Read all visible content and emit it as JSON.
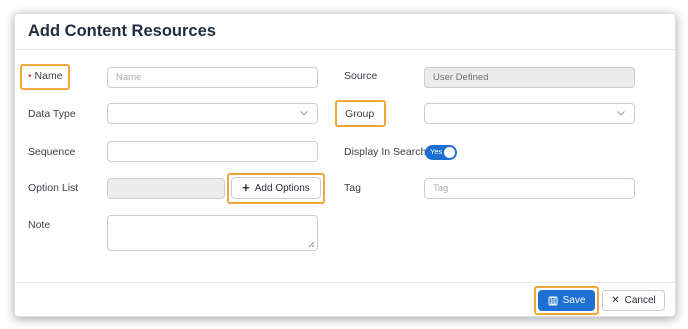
{
  "dialog": {
    "title": "Add Content Resources"
  },
  "form": {
    "name": {
      "label": "Name",
      "required_mark": "•",
      "placeholder": "Name"
    },
    "data_type": {
      "label": "Data Type",
      "value": ""
    },
    "sequence": {
      "label": "Sequence",
      "value": ""
    },
    "option_list": {
      "label": "Option List",
      "value": "",
      "button_label": "Add Options"
    },
    "note": {
      "label": "Note",
      "value": ""
    },
    "source": {
      "label": "Source",
      "value": "User Defined"
    },
    "group": {
      "label": "Group",
      "value": ""
    },
    "display_in_search": {
      "label": "Display In Search",
      "toggle_text": "Yes",
      "enabled": true
    },
    "tag": {
      "label": "Tag",
      "placeholder": "Tag"
    }
  },
  "footer": {
    "save_label": "Save",
    "cancel_label": "Cancel"
  },
  "colors": {
    "accent": "#1d6fd1",
    "highlight": "#f0a73a",
    "required": "#e03b3b"
  },
  "icons": [
    "chevron-down-icon",
    "plus-icon",
    "save-icon",
    "close-icon",
    "resize-grip-icon"
  ]
}
